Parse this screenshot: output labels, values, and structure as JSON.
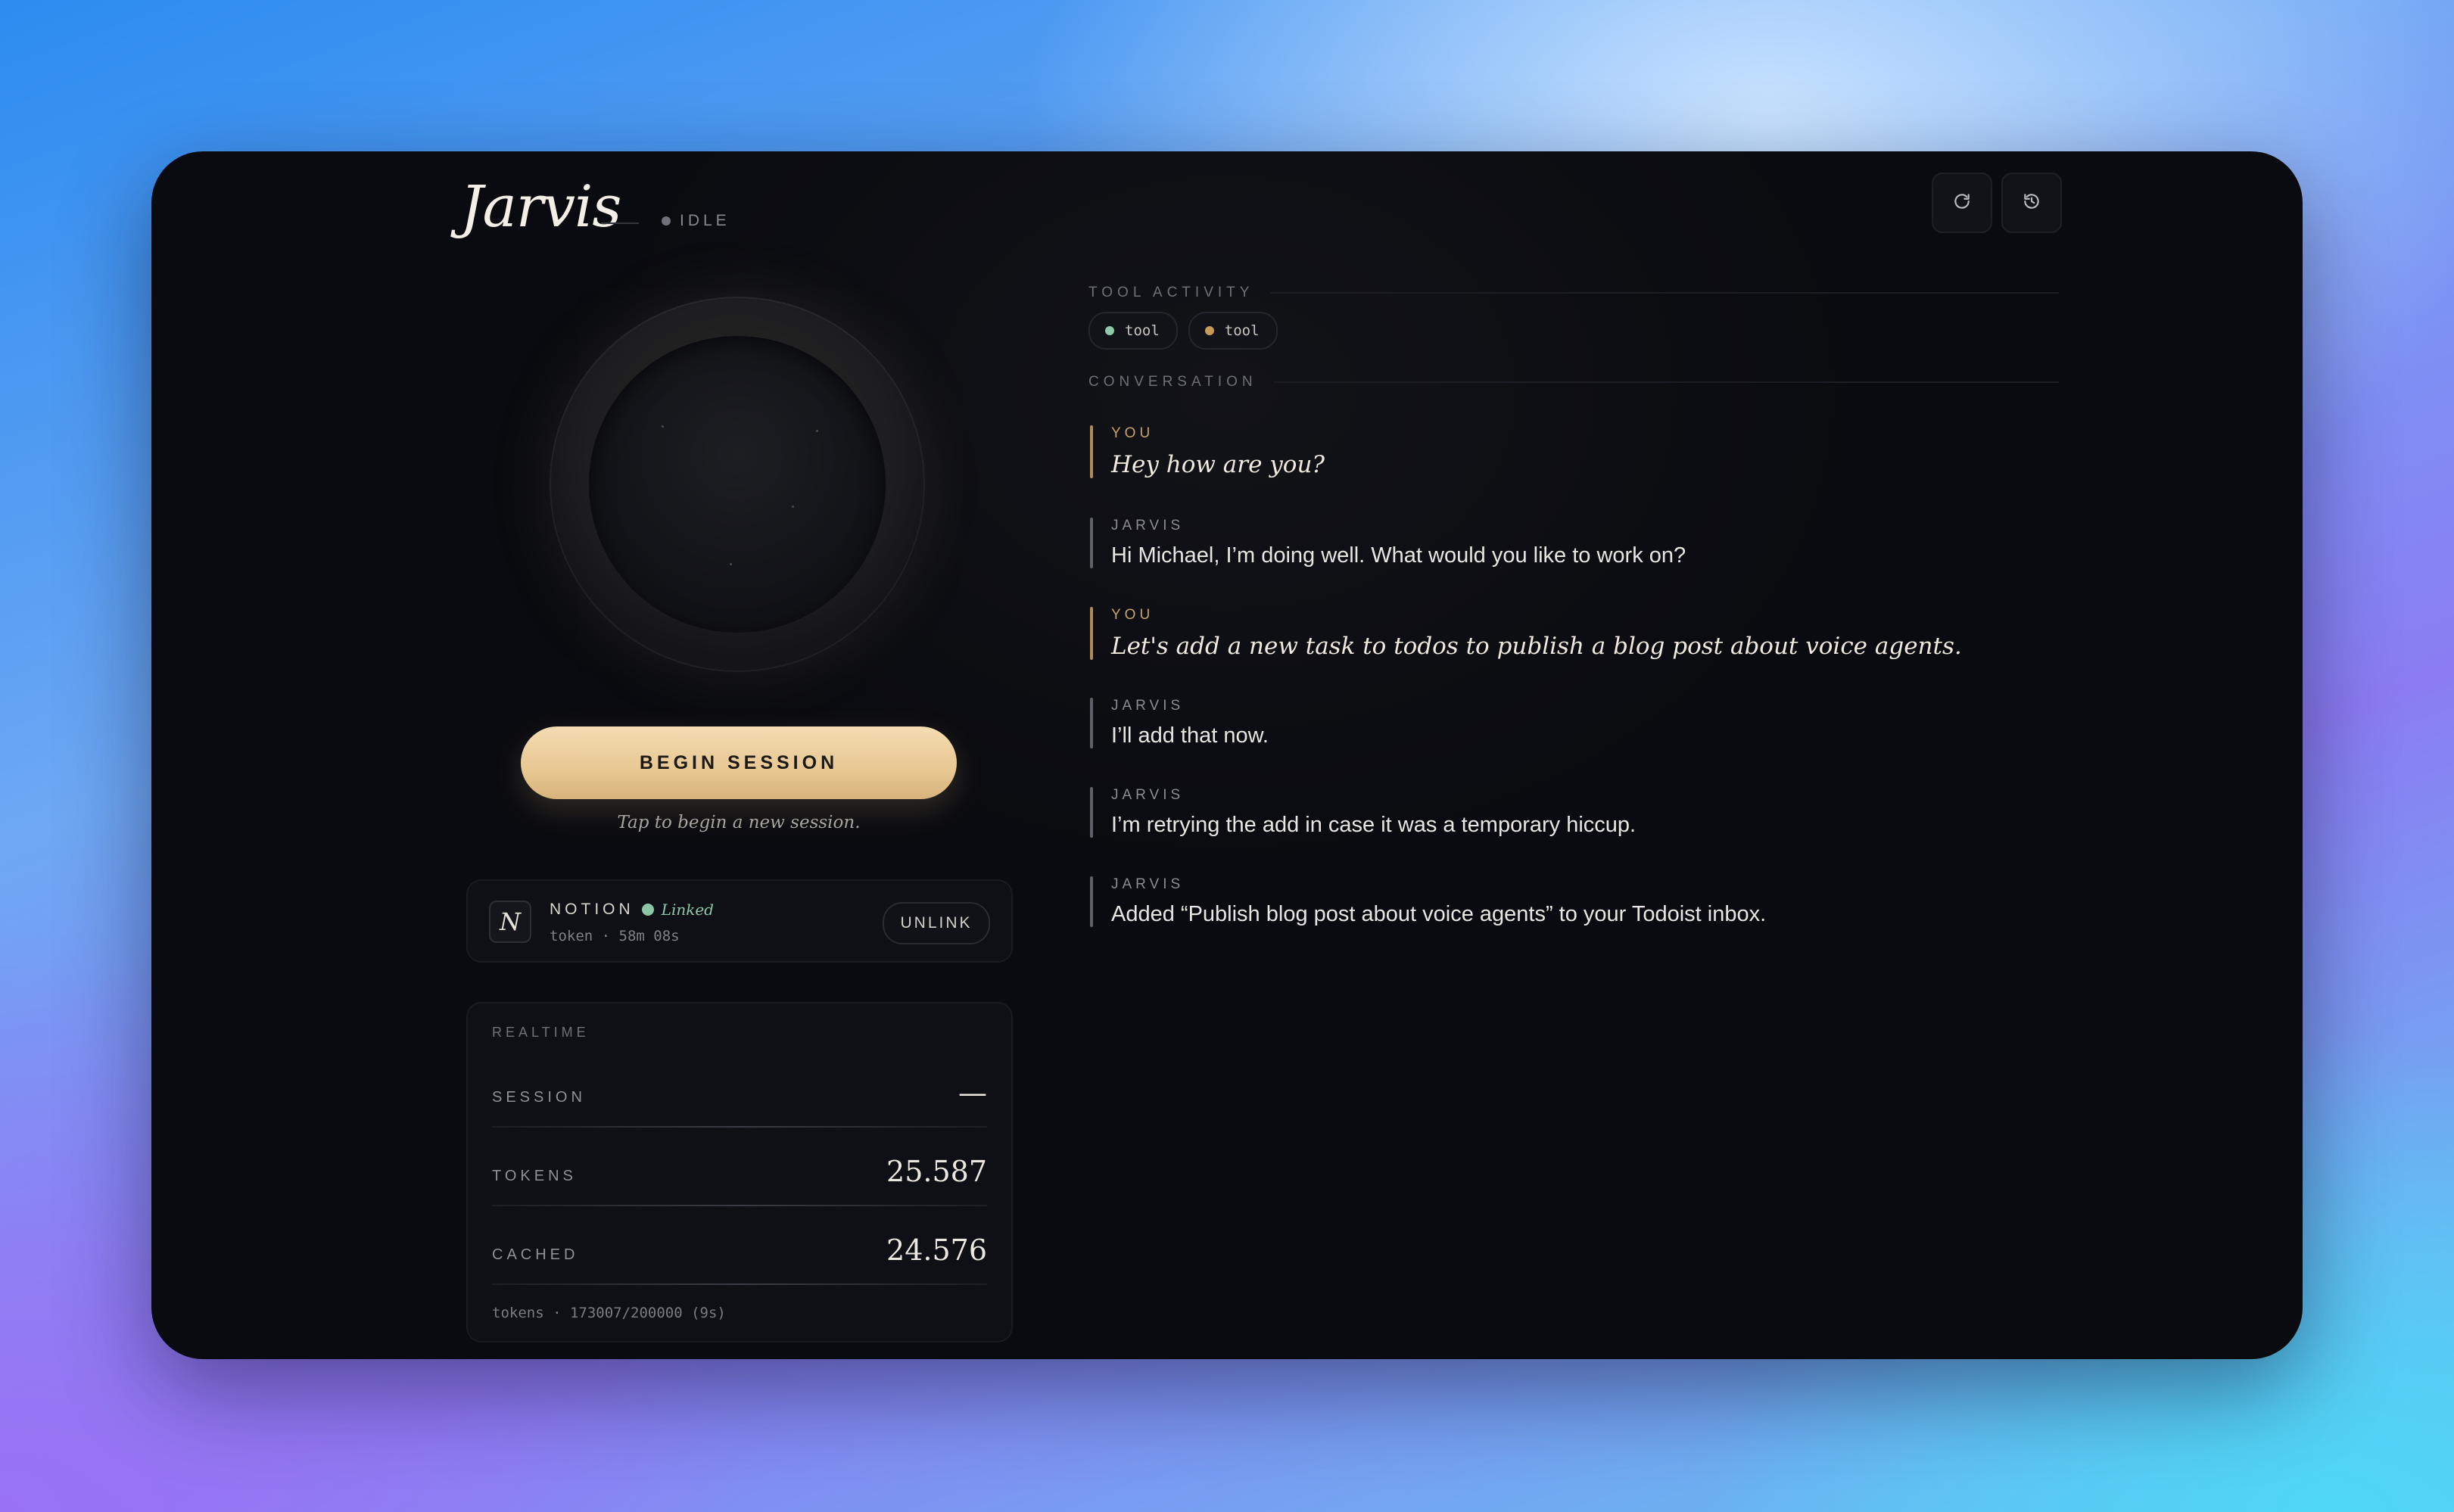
{
  "app": {
    "title": "Jarvis",
    "status": "IDLE"
  },
  "header": {
    "actions": [
      {
        "icon": "refresh-icon"
      },
      {
        "icon": "history-icon"
      }
    ]
  },
  "orb": {
    "state": "idle"
  },
  "session": {
    "button_label": "BEGIN SESSION",
    "hint": "Tap to begin a new session."
  },
  "notion": {
    "badge": "N",
    "name": "NOTION",
    "status": "Linked",
    "token_info": "token · 58m 08s",
    "unlink_label": "UNLINK"
  },
  "realtime": {
    "heading": "REALTIME",
    "rows": [
      {
        "label": "SESSION",
        "value": "—"
      },
      {
        "label": "TOKENS",
        "value": "25.587"
      },
      {
        "label": "CACHED",
        "value": "24.576"
      }
    ],
    "footer": "tokens · 173007/200000 (9s)"
  },
  "tool_activity": {
    "heading": "TOOL ACTIVITY",
    "chips": [
      {
        "label": "tool",
        "color": "#8fc9aa"
      },
      {
        "label": "tool",
        "color": "#c89a5a"
      }
    ]
  },
  "conversation": {
    "heading": "CONVERSATION",
    "messages": [
      {
        "role": "you",
        "speaker": "YOU",
        "text": "Hey how are you?"
      },
      {
        "role": "jarvis",
        "speaker": "JARVIS",
        "text": "Hi Michael, I’m doing well. What would you like to work on?"
      },
      {
        "role": "you",
        "speaker": "YOU",
        "text": "Let's add a new task to todos to publish a blog post about voice agents."
      },
      {
        "role": "jarvis",
        "speaker": "JARVIS",
        "text": "I’ll add that now."
      },
      {
        "role": "jarvis",
        "speaker": "JARVIS",
        "text": "I’m retrying the add in case it was a temporary hiccup."
      },
      {
        "role": "jarvis",
        "speaker": "JARVIS",
        "text": "Added “Publish blog post about voice agents” to your Todoist inbox."
      }
    ]
  },
  "colors": {
    "accent_gold": "#e8c792",
    "linked_green": "#8fc9aa",
    "window_bg": "#0a0b10"
  }
}
